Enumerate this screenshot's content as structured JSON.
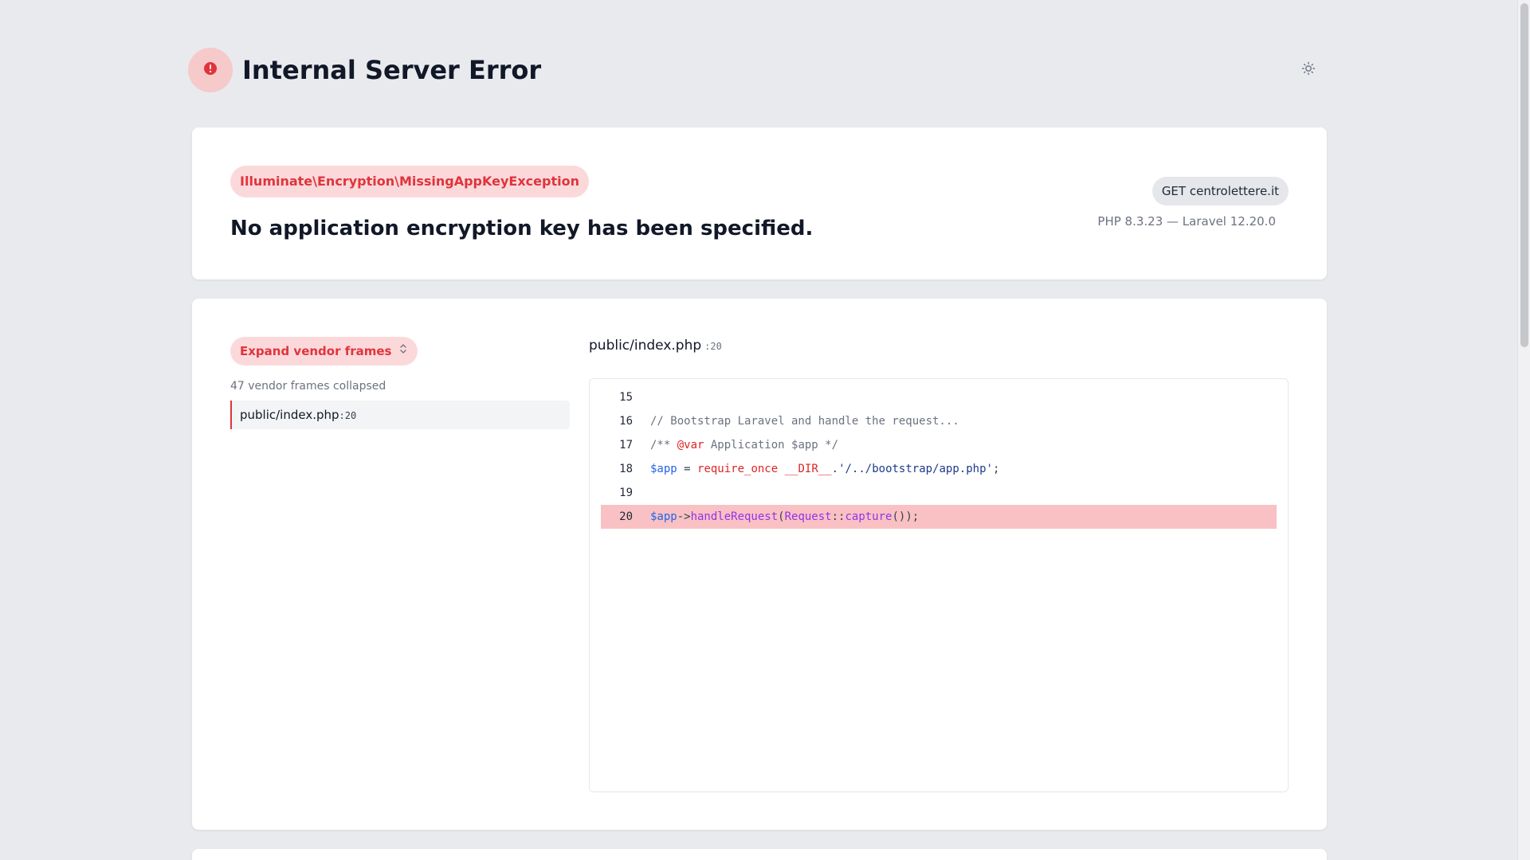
{
  "header": {
    "title": "Internal Server Error",
    "error_icon": "exclamation-circle-icon",
    "theme_icon": "sun-icon"
  },
  "exception": {
    "class": "Illuminate\\Encryption\\MissingAppKeyException",
    "message": "No application encryption key has been specified.",
    "request": "GET centrolettere.it",
    "versions": "PHP 8.3.23 — Laravel 12.20.0"
  },
  "frames": {
    "expand_label": "Expand vendor frames",
    "expand_icon": "chevron-up-down-icon",
    "collapsed_label": "47 vendor frames collapsed",
    "items": [
      {
        "file": "public/index.php",
        "line": ":20"
      }
    ]
  },
  "code": {
    "file": "public/index.php",
    "line": ":20",
    "highlight_line": 20,
    "lines": [
      {
        "no": "15",
        "tokens": []
      },
      {
        "no": "16",
        "tokens": [
          {
            "t": "// Bootstrap Laravel and handle the request...",
            "c": "comment"
          }
        ]
      },
      {
        "no": "17",
        "tokens": [
          {
            "t": "/** ",
            "c": "comment"
          },
          {
            "t": "@var",
            "c": "tag"
          },
          {
            "t": " Application $app */",
            "c": "comment"
          }
        ]
      },
      {
        "no": "18",
        "tokens": [
          {
            "t": "$app",
            "c": "var"
          },
          {
            "t": " = ",
            "c": "op"
          },
          {
            "t": "require_once",
            "c": "kw"
          },
          {
            "t": " ",
            "c": "op"
          },
          {
            "t": "__DIR__",
            "c": "kw"
          },
          {
            "t": ".",
            "c": "op"
          },
          {
            "t": "'/../bootstrap/app.php'",
            "c": "str"
          },
          {
            "t": ";",
            "c": "op"
          }
        ]
      },
      {
        "no": "19",
        "tokens": []
      },
      {
        "no": "20",
        "tokens": [
          {
            "t": "$app",
            "c": "var"
          },
          {
            "t": "->",
            "c": "op"
          },
          {
            "t": "handleRequest",
            "c": "fn"
          },
          {
            "t": "(",
            "c": "op"
          },
          {
            "t": "Request",
            "c": "fn"
          },
          {
            "t": "::",
            "c": "op"
          },
          {
            "t": "capture",
            "c": "fn"
          },
          {
            "t": "());",
            "c": "op"
          }
        ]
      }
    ]
  },
  "colors": {
    "accent": "#e0343d",
    "accent_bg": "#fbd9da",
    "highlight_bg": "#f9c1c3",
    "page_bg": "#e9eaee"
  }
}
